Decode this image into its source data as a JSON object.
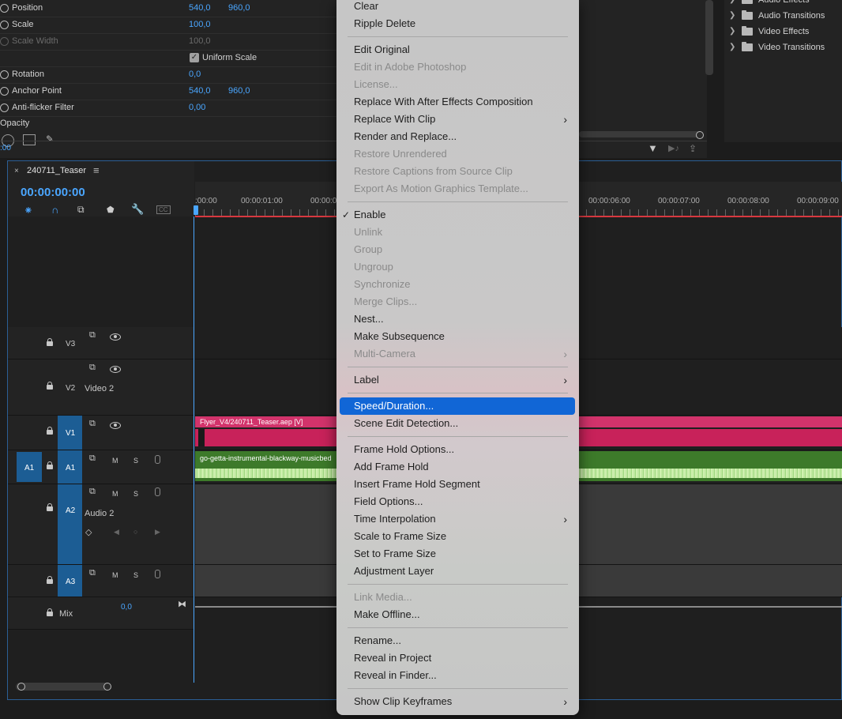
{
  "effect_controls": {
    "rows": [
      {
        "label": "Position",
        "v1": "540,0",
        "v2": "960,0"
      },
      {
        "label": "Scale",
        "v1": "100,0",
        "v2": ""
      },
      {
        "label": "Scale Width",
        "v1": "100,0",
        "v2": ""
      },
      {
        "label": "",
        "v1": "",
        "v2": ""
      },
      {
        "label": "Rotation",
        "v1": "0,0",
        "v2": ""
      },
      {
        "label": "Anchor Point",
        "v1": "540,0",
        "v2": "960,0"
      },
      {
        "label": "Anti-flicker Filter",
        "v1": "0,00",
        "v2": ""
      }
    ],
    "uniform_scale_label": "Uniform Scale",
    "opacity_label": "Opacity",
    "time_fragment": ":00"
  },
  "effects_panel": {
    "items": [
      "Audio Effects",
      "Audio Transitions",
      "Video Effects",
      "Video Transitions"
    ]
  },
  "timeline": {
    "sequence_name": "240711_Teaser",
    "timecode": "00:00:00:00",
    "ruler_labels": [
      ":00:00",
      "00:00:01:00",
      "00:00:0",
      "00:00:06:00",
      "00:00:07:00",
      "00:00:08:00",
      "00:00:09:00"
    ],
    "tracks": {
      "v3": "V3",
      "v2": "V2",
      "v2_name": "Video 2",
      "v1": "V1",
      "a1_source": "A1",
      "a1": "A1",
      "a2": "A2",
      "a2_name": "Audio 2",
      "a3": "A3",
      "mix": "Mix",
      "mix_value": "0,0",
      "m": "M",
      "s": "S"
    },
    "video_clip": "Flyer_V4/240711_Teaser.aep [V]",
    "audio_clip": "go-getta-instrumental-blackway-musicbed",
    "colors": {
      "video_clip": "#c8225a",
      "audio_clip": "#3d7a2a",
      "waveform": "#bfe8a0",
      "accent": "#4aa6ff"
    }
  },
  "context_menu": {
    "items": [
      {
        "label": "Clear",
        "state": "enabled"
      },
      {
        "label": "Ripple Delete",
        "state": "enabled"
      },
      {
        "label": "Edit Original",
        "state": "enabled"
      },
      {
        "label": "Edit in Adobe Photoshop",
        "state": "disabled"
      },
      {
        "label": "License...",
        "state": "disabled"
      },
      {
        "label": "Replace With After Effects Composition",
        "state": "enabled"
      },
      {
        "label": "Replace With Clip",
        "state": "enabled",
        "submenu": true
      },
      {
        "label": "Render and Replace...",
        "state": "enabled"
      },
      {
        "label": "Restore Unrendered",
        "state": "disabled"
      },
      {
        "label": "Restore Captions from Source Clip",
        "state": "disabled"
      },
      {
        "label": "Export As Motion Graphics Template...",
        "state": "disabled"
      },
      {
        "label": "Enable",
        "state": "enabled",
        "checked": true
      },
      {
        "label": "Unlink",
        "state": "disabled"
      },
      {
        "label": "Group",
        "state": "disabled"
      },
      {
        "label": "Ungroup",
        "state": "disabled"
      },
      {
        "label": "Synchronize",
        "state": "disabled"
      },
      {
        "label": "Merge Clips...",
        "state": "disabled"
      },
      {
        "label": "Nest...",
        "state": "enabled"
      },
      {
        "label": "Make Subsequence",
        "state": "enabled"
      },
      {
        "label": "Multi-Camera",
        "state": "disabled",
        "submenu": true
      },
      {
        "label": "Label",
        "state": "enabled",
        "submenu": true
      },
      {
        "label": "Speed/Duration...",
        "state": "selected"
      },
      {
        "label": "Scene Edit Detection...",
        "state": "enabled"
      },
      {
        "label": "Frame Hold Options...",
        "state": "enabled"
      },
      {
        "label": "Add Frame Hold",
        "state": "enabled"
      },
      {
        "label": "Insert Frame Hold Segment",
        "state": "enabled"
      },
      {
        "label": "Field Options...",
        "state": "enabled"
      },
      {
        "label": "Time Interpolation",
        "state": "enabled",
        "submenu": true
      },
      {
        "label": "Scale to Frame Size",
        "state": "enabled"
      },
      {
        "label": "Set to Frame Size",
        "state": "enabled"
      },
      {
        "label": "Adjustment Layer",
        "state": "enabled"
      },
      {
        "label": "Link Media...",
        "state": "disabled"
      },
      {
        "label": "Make Offline...",
        "state": "enabled"
      },
      {
        "label": "Rename...",
        "state": "enabled"
      },
      {
        "label": "Reveal in Project",
        "state": "enabled"
      },
      {
        "label": "Reveal in Finder...",
        "state": "enabled"
      },
      {
        "label": "Show Clip Keyframes",
        "state": "enabled",
        "submenu": true
      }
    ]
  }
}
